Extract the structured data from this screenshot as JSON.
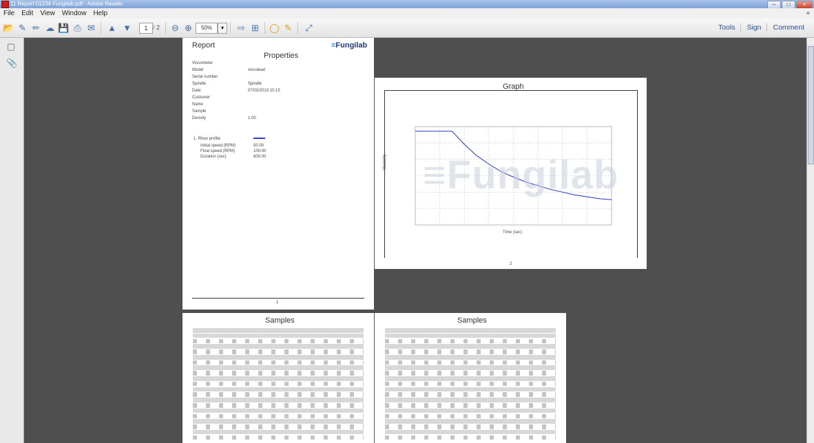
{
  "window": {
    "title": "11 Report 01234 Fungilab.pdf - Adobe Reader",
    "min": "–",
    "max": "□",
    "close": "×"
  },
  "menu": {
    "items": [
      "File",
      "Edit",
      "View",
      "Window",
      "Help"
    ],
    "doc_close": "×"
  },
  "toolbar": {
    "page_current": "1",
    "page_total": "/ 2",
    "zoom": "50%",
    "zoom_drop": "▾",
    "right": [
      "Tools",
      "Sign",
      "Comment"
    ]
  },
  "pages": {
    "p1": {
      "report_label": "Report",
      "heading": "Properties",
      "brand": "Fungilab",
      "rows": [
        [
          "Viscometer",
          ""
        ],
        [
          "Model",
          "viscolead"
        ],
        [
          "Serial number",
          ""
        ],
        [
          "Spindle",
          "Spindle"
        ],
        [
          "Date",
          "07/03/2013 10:15"
        ],
        [
          "Customer",
          ""
        ],
        [
          "Name",
          ""
        ],
        [
          "Sample",
          ""
        ],
        [
          "Density",
          "1.00"
        ]
      ],
      "series_label": "1. Rheo profile",
      "rows2": [
        [
          "Initial speed (RPM)",
          "50.00"
        ],
        [
          "Final speed (RPM)",
          "100.00"
        ],
        [
          "Duration (sec)",
          "600.00"
        ]
      ],
      "page_no": "1"
    },
    "p2": {
      "heading": "Graph",
      "ylabel": "Viscosity",
      "xlabel": "Time (sec)",
      "watermark": "Fungilab",
      "page_no": "2"
    },
    "p3": {
      "heading": "Samples"
    },
    "p4": {
      "heading": "Samples"
    }
  },
  "chart_data": {
    "type": "line",
    "title": "Graph",
    "xlabel": "Time (sec)",
    "ylabel": "Viscosity",
    "x": [
      0,
      10,
      20,
      30,
      40,
      50,
      60,
      70,
      80,
      90,
      100,
      110,
      120,
      130,
      140,
      150,
      160
    ],
    "series": [
      {
        "values": [
          1.0,
          1.0,
          1.0,
          1.0,
          0.86,
          0.74,
          0.65,
          0.57,
          0.51,
          0.46,
          0.42,
          0.38,
          0.35,
          0.32,
          0.3,
          0.28,
          0.27
        ]
      }
    ],
    "ylim": [
      0.0,
      1.05
    ],
    "xlim": [
      0,
      160
    ],
    "grid": true,
    "colors": {
      "line": "#2233bb"
    }
  },
  "icons": {
    "nav": [
      "pages-icon",
      "attachment-icon"
    ]
  }
}
